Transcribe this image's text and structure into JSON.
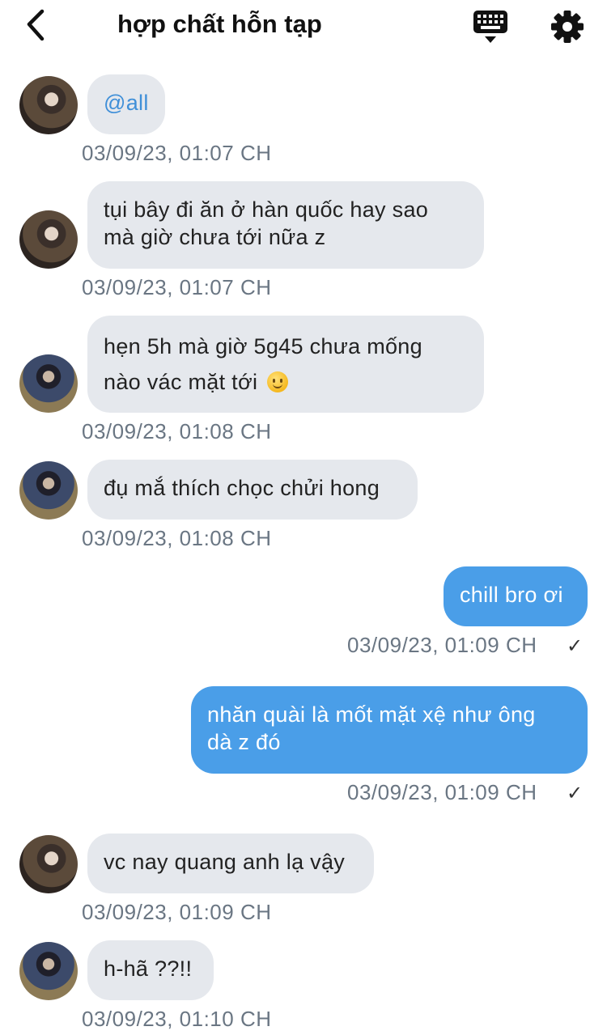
{
  "header": {
    "title": "hợp chất hỗn tạp",
    "back_icon": "chevron-left-icon",
    "keyboard_icon": "keyboard-icon",
    "settings_icon": "gear-icon"
  },
  "messages": [
    {
      "direction": "in",
      "avatar": "member-1",
      "text": "@all",
      "time": "03/09/23, 01:07 CH"
    },
    {
      "direction": "in",
      "avatar": "member-1",
      "line1": "tụi bây đi ăn ở hàn quốc hay sao",
      "line2": "mà giờ chưa tới nữa z",
      "time": "03/09/23, 01:07 CH"
    },
    {
      "direction": "in",
      "avatar": "member-2",
      "line1": "hẹn 5h mà giờ 5g45 chưa mống",
      "line2": "nào vác mặt tới",
      "emoji": "slightly-smiling-face-emoji",
      "time": "03/09/23, 01:08 CH"
    },
    {
      "direction": "in",
      "avatar": "member-2",
      "text": "đụ mắ thích chọc chửi hong",
      "time": "03/09/23, 01:08 CH"
    },
    {
      "direction": "out",
      "text": "chill bro ơi",
      "time": "03/09/23, 01:09 CH",
      "status": "✓"
    },
    {
      "direction": "out",
      "line1": "nhăn quài là mốt mặt xệ như ông",
      "line2": "dà z đó",
      "time": "03/09/23, 01:09 CH",
      "status": "✓"
    },
    {
      "direction": "in",
      "avatar": "member-1",
      "text": "vc nay quang anh lạ vậy",
      "time": "03/09/23, 01:09 CH"
    },
    {
      "direction": "in",
      "avatar": "member-2",
      "text": "h-hã ??!!",
      "time": "03/09/23, 01:10 CH"
    }
  ],
  "colors": {
    "incoming_bubble": "#e5e8ed",
    "outgoing_bubble": "#4a9ee8",
    "mention": "#3f8fd8",
    "timestamp": "#6a7683"
  }
}
